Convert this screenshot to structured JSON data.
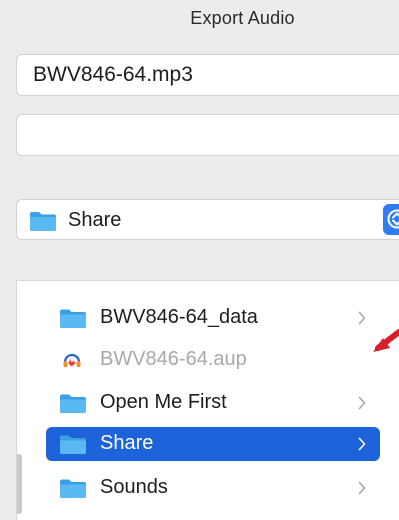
{
  "dialog": {
    "title": "Export Audio"
  },
  "save_as": {
    "value": "BWV846-64.mp3",
    "placeholder": ""
  },
  "tags": {
    "value": "",
    "placeholder": ""
  },
  "location": {
    "selected": "Share",
    "icon": "folder-icon"
  },
  "browser": {
    "items": [
      {
        "name": "BWV846-64_data",
        "icon": "folder-icon",
        "has_children": true,
        "enabled": true,
        "selected": false
      },
      {
        "name": "BWV846-64.aup",
        "icon": "audacity-project-icon",
        "has_children": false,
        "enabled": false,
        "selected": false
      },
      {
        "name": "Open Me First",
        "icon": "folder-icon",
        "has_children": true,
        "enabled": true,
        "selected": false
      },
      {
        "name": "Share",
        "icon": "folder-icon",
        "has_children": true,
        "enabled": true,
        "selected": true
      },
      {
        "name": "Sounds",
        "icon": "folder-icon",
        "has_children": true,
        "enabled": true,
        "selected": false
      }
    ]
  },
  "colors": {
    "accent": "#1e63d9",
    "folder": "#3aa0e6",
    "annotation": "#d8202a",
    "background": "#ececec"
  }
}
